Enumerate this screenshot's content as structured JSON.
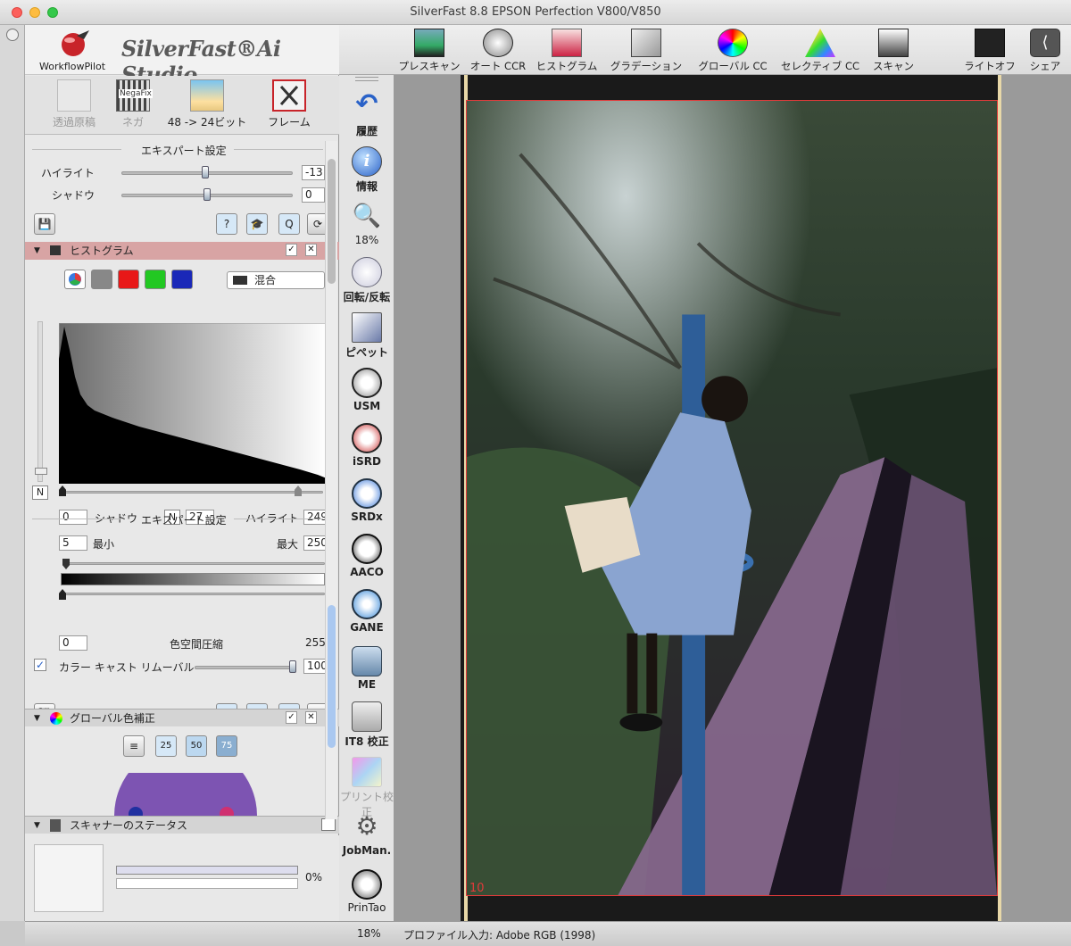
{
  "window": {
    "title": "SilverFast 8.8 EPSON Perfection V800/V850"
  },
  "brand": {
    "product": "SilverFast®Ai Studio",
    "workflow_pilot": "WorkflowPilot"
  },
  "modes": [
    {
      "label": "透過原稿"
    },
    {
      "label": "ネガ",
      "badge": "NegaFix"
    },
    {
      "label": "48 -> 24ビット"
    },
    {
      "label": "フレーム"
    }
  ],
  "expert1": {
    "title": "エキスパート設定",
    "highlight_label": "ハイライト",
    "highlight_value": "-13",
    "highlight_level": 0.49,
    "shadow_label": "シャドウ",
    "shadow_value": "0",
    "shadow_level": 0.5
  },
  "histogram": {
    "title": "ヒストグラム",
    "mode_select": "混合",
    "n_label": "N",
    "shadow_value": "0",
    "shadow_label": "シャドウ",
    "mid_value": "27",
    "highlight_label": "ハイライト",
    "highlight_value": "249"
  },
  "expert2": {
    "title": "エキスパート設定",
    "min_value": "5",
    "min_label": "最小",
    "max_label": "最大",
    "max_value": "250",
    "gamut_low": "0",
    "gamut_label": "色空間圧縮",
    "gamut_high": "255",
    "cast_label": "カラー キャスト リムーバル",
    "cast_value": "100",
    "cast_checked": true
  },
  "global_cc": {
    "title": "グローバル色補正",
    "b25": "25",
    "b50": "50",
    "b75": "75"
  },
  "scanner_status": {
    "title": "スキャナーのステータス",
    "progress": "0%",
    "progress_value": 0
  },
  "toolbar": [
    {
      "label": "プレスキャン",
      "icon": "prescan-icon"
    },
    {
      "label": "オート CCR",
      "icon": "auto-ccr-icon"
    },
    {
      "label": "ヒストグラム",
      "icon": "histogram-icon"
    },
    {
      "label": "グラデーション",
      "icon": "gradation-icon"
    },
    {
      "label": "グローバル CC",
      "icon": "global-cc-icon"
    },
    {
      "label": "セレクティブ CC",
      "icon": "selective-cc-icon"
    },
    {
      "label": "スキャン",
      "icon": "scan-icon"
    },
    {
      "label": "ライトオフ",
      "icon": "light-off-icon"
    },
    {
      "label": "シェア",
      "icon": "share-icon"
    }
  ],
  "sidetools": [
    {
      "label": "履歴",
      "icon": "history-icon"
    },
    {
      "label": "情報",
      "icon": "info-icon"
    },
    {
      "label": "18%",
      "icon": "zoom-icon"
    },
    {
      "label": "回転/反転",
      "icon": "rotate-icon"
    },
    {
      "label": "ピペット",
      "icon": "pipette-icon"
    },
    {
      "label": "USM",
      "icon": "usm-icon"
    },
    {
      "label": "iSRD",
      "icon": "isrd-icon"
    },
    {
      "label": "SRDx",
      "icon": "srdx-icon"
    },
    {
      "label": "AACO",
      "icon": "aaco-icon"
    },
    {
      "label": "GANE",
      "icon": "gane-icon"
    },
    {
      "label": "ME",
      "icon": "me-icon"
    },
    {
      "label": "IT8 校正",
      "icon": "it8-icon"
    },
    {
      "label": "プリント校正",
      "icon": "print-calibration-icon"
    },
    {
      "label": "JobMan.",
      "icon": "jobman-icon"
    },
    {
      "label": "PrinTao",
      "icon": "printao-icon"
    }
  ],
  "preview": {
    "frame_number": "10"
  },
  "status": {
    "zoom": "18%",
    "profile": "プロファイル入力: Adobe RGB (1998)"
  },
  "colors": {
    "accent_red": "#e23a3a",
    "section_header": "#d8a4a4",
    "blue": "#2a62c8"
  }
}
